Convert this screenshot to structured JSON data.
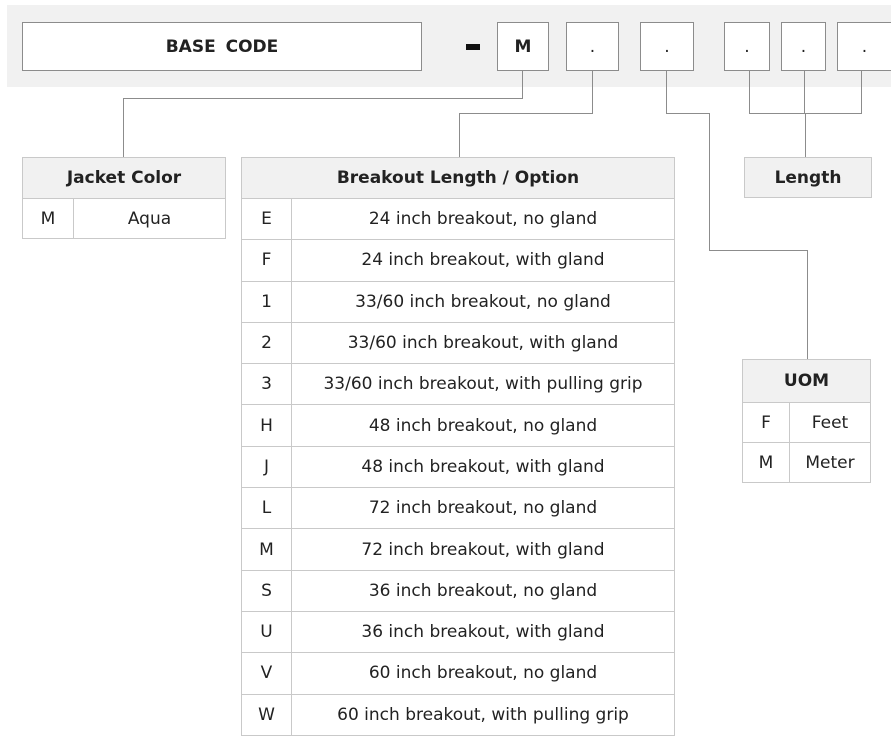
{
  "code_bar": {
    "base_label": "BASE CODE",
    "separator": "-",
    "segments": [
      "M",
      ".",
      ".",
      ".",
      ".",
      "."
    ]
  },
  "jacket_color": {
    "header": "Jacket Color",
    "rows": [
      {
        "code": "M",
        "label": "Aqua"
      }
    ]
  },
  "breakout": {
    "header": "Breakout Length / Option",
    "rows": [
      {
        "code": "E",
        "label": "24 inch breakout, no gland"
      },
      {
        "code": "F",
        "label": "24 inch breakout, with gland"
      },
      {
        "code": "1",
        "label": "33/60 inch breakout, no gland"
      },
      {
        "code": "2",
        "label": "33/60 inch breakout, with gland"
      },
      {
        "code": "3",
        "label": "33/60 inch breakout, with pulling grip"
      },
      {
        "code": "H",
        "label": "48 inch breakout, no gland"
      },
      {
        "code": "J",
        "label": "48 inch breakout, with gland"
      },
      {
        "code": "L",
        "label": "72 inch breakout, no gland"
      },
      {
        "code": "M",
        "label": "72 inch breakout, with gland"
      },
      {
        "code": "S",
        "label": "36 inch breakout, no gland"
      },
      {
        "code": "U",
        "label": "36 inch breakout, with gland"
      },
      {
        "code": "V",
        "label": "60 inch breakout, no gland"
      },
      {
        "code": "W",
        "label": "60 inch breakout, with pulling grip"
      }
    ]
  },
  "length": {
    "header": "Length"
  },
  "uom": {
    "header": "UOM",
    "rows": [
      {
        "code": "F",
        "label": "Feet"
      },
      {
        "code": "M",
        "label": "Meter"
      }
    ]
  }
}
